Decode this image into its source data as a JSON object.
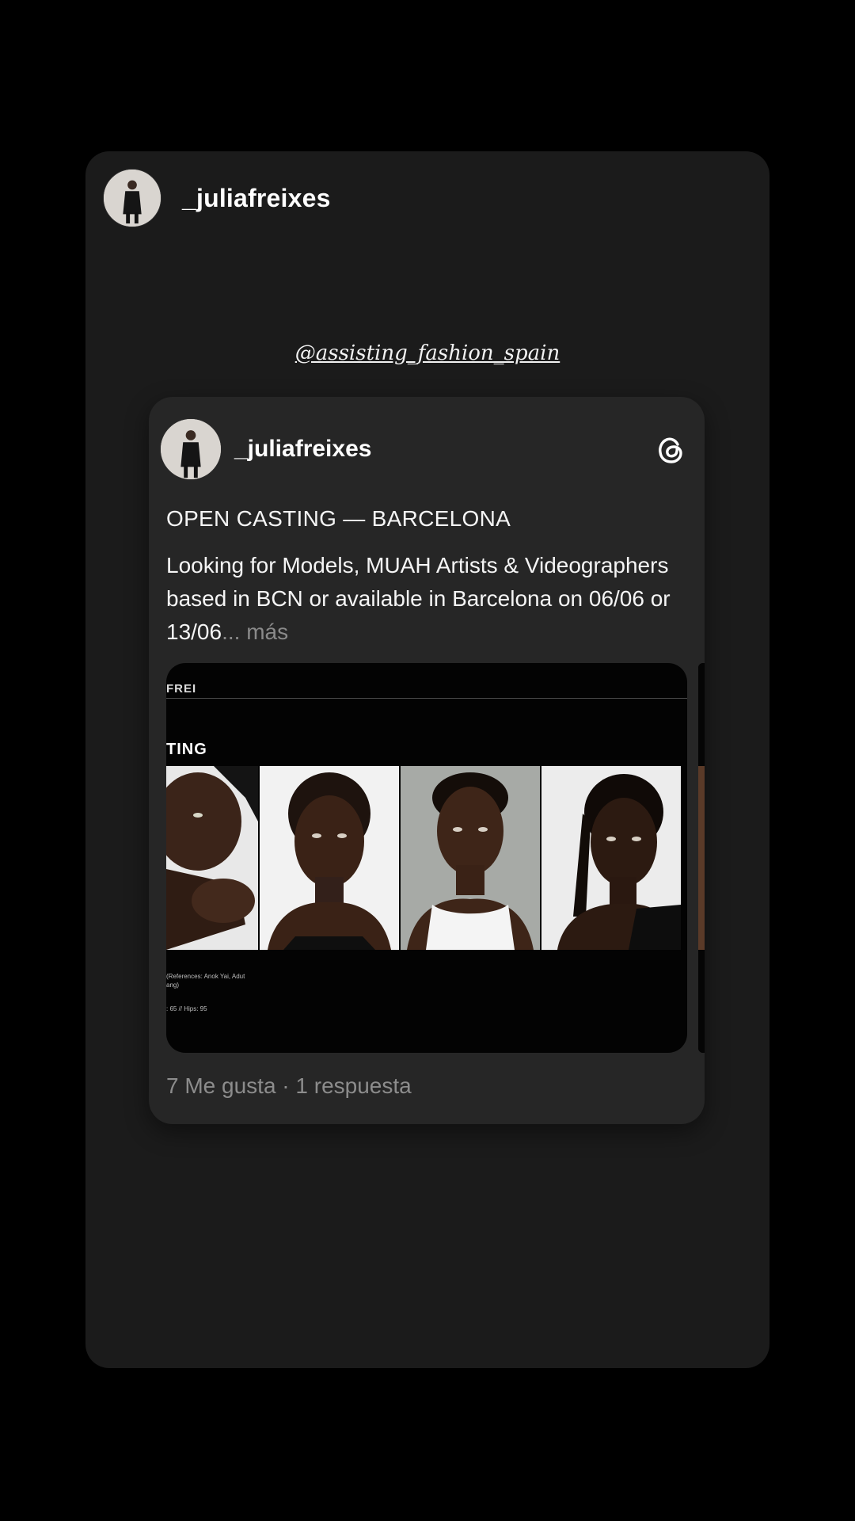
{
  "story": {
    "username": "_juliafreixes",
    "mention": "@assisting_fashion_spain"
  },
  "post": {
    "username": "_juliafreixes",
    "platform_icon": "threads-icon",
    "title": "OPEN CASTING — BARCELONA",
    "body": "Looking for Models, MUAH Artists & Videographers based in BCN or available in Barcelona on 06/06 or 13/06",
    "more_label": "... más",
    "media": {
      "brand_fragment": "FREI",
      "heading_fragment": "TING",
      "caption_line_1": "(References: Anok Yai, Adut",
      "caption_line_1b": "ang)",
      "caption_line_2": ": 65 // Hips: 95"
    },
    "footer": "7 Me gusta · 1 respuesta"
  },
  "colors": {
    "background": "#000000",
    "story_card": "#1b1b1b",
    "post_card": "#262626",
    "muted_text": "#8c8c8c"
  }
}
